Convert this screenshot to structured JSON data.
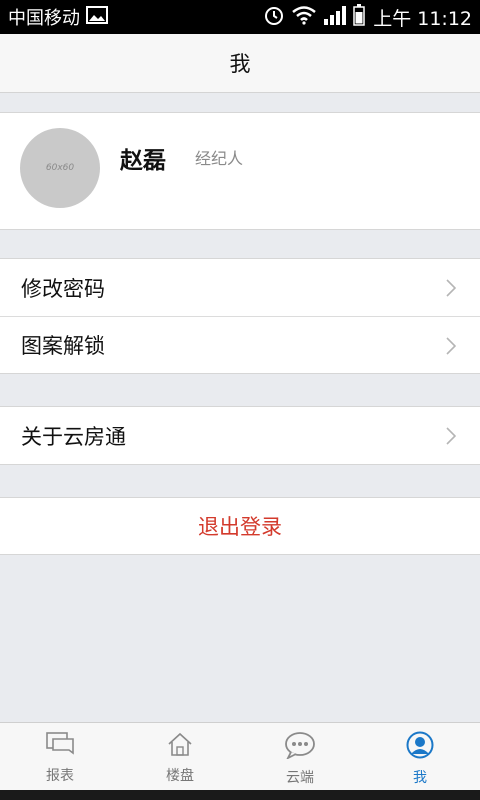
{
  "status_bar": {
    "carrier": "中国移动",
    "time": "上午 11:12"
  },
  "header": {
    "title": "我"
  },
  "profile": {
    "name": "赵磊",
    "role": "经纪人",
    "avatar_placeholder": "60x60"
  },
  "menu_groups": [
    [
      {
        "label": "修改密码"
      },
      {
        "label": "图案解锁"
      }
    ],
    [
      {
        "label": "关于云房通"
      }
    ]
  ],
  "logout": {
    "label": "退出登录",
    "color": "#d33a2c"
  },
  "tabs": [
    {
      "label": "报表",
      "icon": "report-icon",
      "active": false
    },
    {
      "label": "楼盘",
      "icon": "home-icon",
      "active": false
    },
    {
      "label": "云端",
      "icon": "chat-icon",
      "active": false
    },
    {
      "label": "我",
      "icon": "user-icon",
      "active": true
    }
  ],
  "colors": {
    "accent": "#1b78c8",
    "background": "#e9ebef"
  }
}
